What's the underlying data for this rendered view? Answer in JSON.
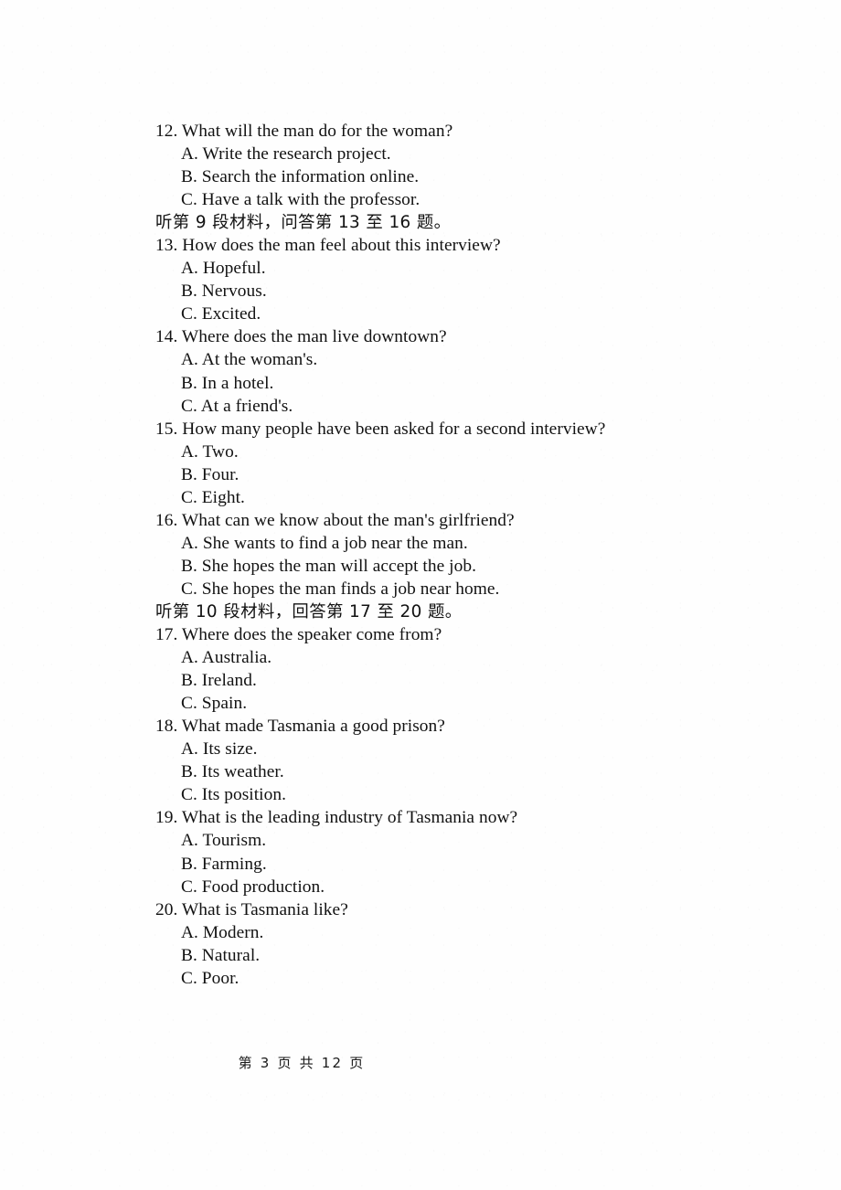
{
  "document": {
    "blocks": [
      {
        "kind": "question",
        "text": "12. What will the man do for the woman?",
        "options": [
          "A. Write the research project.",
          "B. Search the information online.",
          "C. Have a talk with the professor."
        ]
      },
      {
        "kind": "instruction",
        "text": "听第 9 段材料，问答第 13 至 16 题。"
      },
      {
        "kind": "question",
        "text": "13. How does the man feel about this interview?",
        "options": [
          "A. Hopeful.",
          "B. Nervous.",
          "C. Excited."
        ]
      },
      {
        "kind": "question",
        "text": "14. Where does the man live downtown?",
        "options": [
          "A. At the woman's.",
          "B. In a hotel.",
          "C. At a friend's."
        ]
      },
      {
        "kind": "question",
        "text": "15. How many people have been asked for a second interview?",
        "options": [
          "A. Two.",
          "B. Four.",
          "C. Eight."
        ]
      },
      {
        "kind": "question",
        "text": "16. What can we know about the man's girlfriend?",
        "options": [
          "A. She wants to find a job near the man.",
          "B. She hopes the man will accept the job.",
          "C. She hopes the man finds a job near home."
        ]
      },
      {
        "kind": "instruction",
        "text": "听第 10 段材料，回答第 17 至 20 题。"
      },
      {
        "kind": "question",
        "text": "17. Where does the speaker come from?",
        "options": [
          "A. Australia.",
          "B. Ireland.",
          "C. Spain."
        ]
      },
      {
        "kind": "question",
        "text": "18. What made Tasmania a good prison?",
        "options": [
          "A. Its size.",
          "B. Its weather.",
          "C. Its position."
        ]
      },
      {
        "kind": "question",
        "text": "19. What is the leading industry of Tasmania now?",
        "options": [
          "A. Tourism.",
          "B. Farming.",
          "C. Food production."
        ]
      },
      {
        "kind": "question",
        "text": "20. What is Tasmania like?",
        "options": [
          "A. Modern.",
          "B. Natural.",
          "C. Poor."
        ]
      }
    ],
    "footer": "第 3 页 共 12 页"
  }
}
